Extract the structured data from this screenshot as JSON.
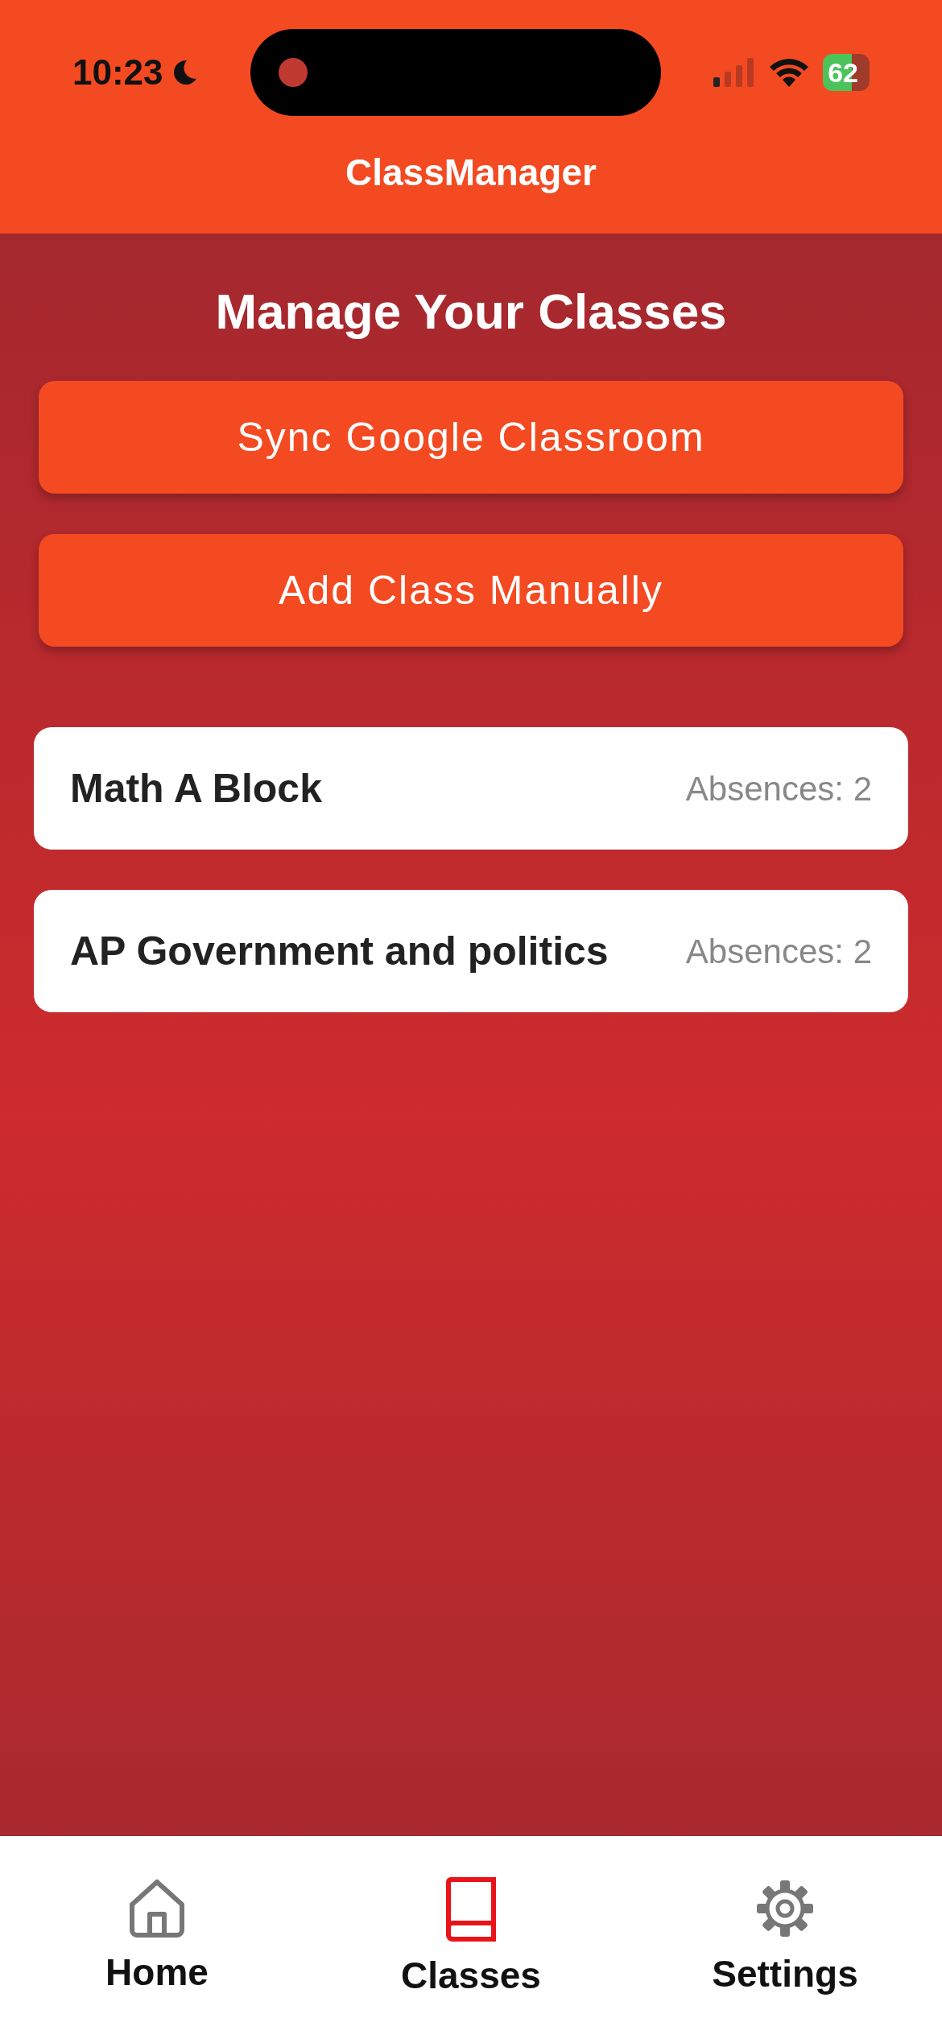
{
  "status_bar": {
    "time": "10:23",
    "battery": "62"
  },
  "header": {
    "title": "ClassManager"
  },
  "page": {
    "title": "Manage Your Classes"
  },
  "buttons": [
    "Sync Google Classroom",
    "Add Class Manually"
  ],
  "classes": [
    {
      "name": "Math A Block",
      "absences": "Absences: 2"
    },
    {
      "name": "AP Government and politics",
      "absences": "Absences: 2"
    }
  ],
  "tab_bar": [
    {
      "label": "Home",
      "kind": "home",
      "selected": false
    },
    {
      "label": "Classes",
      "kind": "book",
      "selected": true
    },
    {
      "label": "Settings",
      "kind": "gear",
      "selected": false
    }
  ]
}
